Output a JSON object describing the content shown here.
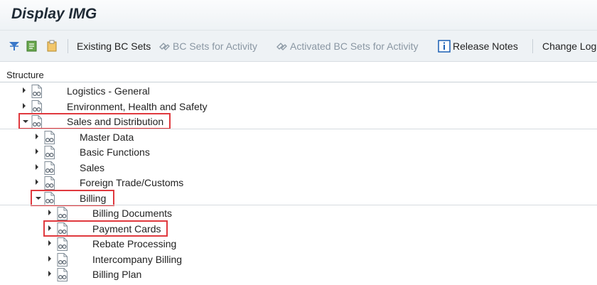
{
  "window": {
    "title": "Display IMG"
  },
  "toolbar": {
    "existing_bc_sets": "Existing BC Sets",
    "bc_sets_for_activity": "BC Sets for Activity",
    "activated_bc_sets": "Activated BC Sets for Activity",
    "release_notes": "Release Notes",
    "change_log": "Change Log"
  },
  "structure": {
    "header": "Structure",
    "items": [
      {
        "label": "Logistics - General",
        "level": 0,
        "expanded": false
      },
      {
        "label": "Environment, Health and Safety",
        "level": 0,
        "expanded": false
      },
      {
        "label": "Sales and Distribution",
        "level": 0,
        "expanded": true,
        "highlighted": true
      },
      {
        "label": "Master Data",
        "level": 1,
        "expanded": false
      },
      {
        "label": "Basic Functions",
        "level": 1,
        "expanded": false
      },
      {
        "label": "Sales",
        "level": 1,
        "expanded": false
      },
      {
        "label": "Foreign Trade/Customs",
        "level": 1,
        "expanded": false
      },
      {
        "label": "Billing",
        "level": 1,
        "expanded": true,
        "highlighted": true
      },
      {
        "label": "Billing Documents",
        "level": 2,
        "expanded": false
      },
      {
        "label": "Payment Cards",
        "level": 2,
        "expanded": false,
        "highlighted": true
      },
      {
        "label": "Rebate Processing",
        "level": 2,
        "expanded": false
      },
      {
        "label": "Intercompany Billing",
        "level": 2,
        "expanded": false
      },
      {
        "label": "Billing Plan",
        "level": 2,
        "expanded": false
      }
    ]
  },
  "colors": {
    "highlight_border": "#e0393e",
    "toolbar_bg": "#eef2f5",
    "disabled_text": "#8a97a3"
  }
}
